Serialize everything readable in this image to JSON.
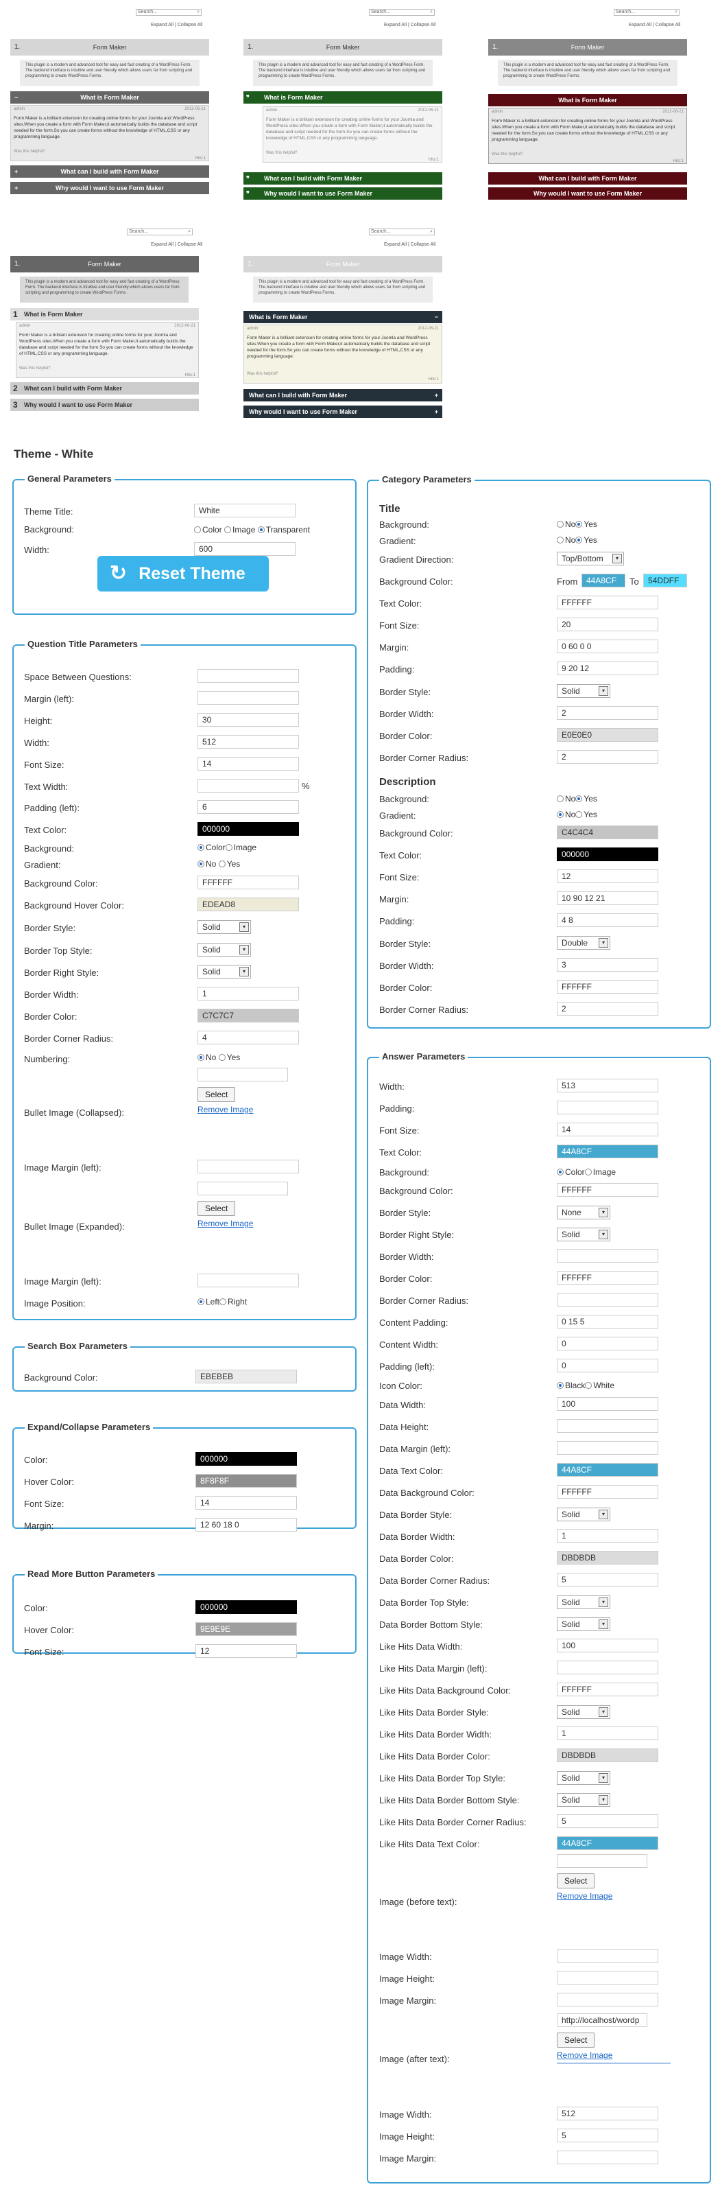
{
  "thumbs": {
    "search_placeholder": "Search...",
    "expand": "Expand All | Collapse All",
    "title": "Form Maker",
    "num": "1.",
    "desc": "This plugin is a modern and advanced tool for easy and fast creating of a WordPress Form. The backend interface is intuitive and user friendly which allows users far from scripting and programming to create WordPress Forms.",
    "q1": "What is Form Maker",
    "q2": "What can I build with Form Maker",
    "q3": "Why would I want to use Form Maker",
    "author": "admin",
    "date": "2012-06-21",
    "answer": "Form Maker is a brilliant extension for creating online forms for your Joomla and WordPress sites.When you create a form with Form Maker,it automatically builds the database and script needed for the form.So you can create forms without the knowledge of HTML,CSS or any programming language.",
    "was_helpful": "Was this helpful?",
    "hits": "Hits:1"
  },
  "colors": {
    "accent": "#3da3d8",
    "reset": "#3ab4ea",
    "t1": "#666666",
    "t2": "#1e5c1e",
    "t3": "#5a0b12",
    "t5": "#25313a"
  },
  "theme_heading": "Theme - White",
  "general": {
    "legend": "General Parameters",
    "theme_title_label": "Theme Title:",
    "theme_title": "White",
    "background_label": "Background:",
    "bg_color": "Color",
    "bg_image": "Image",
    "bg_transparent": "Transparent",
    "width_label": "Width:",
    "width": "600",
    "reset": "Reset Theme"
  },
  "qt": {
    "legend": "Question Title Parameters",
    "labels": [
      "Space Between Questions:",
      "Margin (left):",
      "Height:",
      "Width:",
      "Font Size:",
      "Text Width:",
      "Padding (left):",
      "Text Color:",
      "Background:",
      "Gradient:",
      "Background Color:",
      "Background Hover Color:",
      "Border Style:",
      "Border Top Style:",
      "Border Right Style:",
      "Border Width:",
      "Border Color:",
      "Border Corner Radius:",
      "Numbering:",
      "Bullet Image (Collapsed):",
      "Image Margin (left):",
      "Bullet Image (Expanded):",
      "Image Margin (left):",
      "Image Position:"
    ],
    "height": "30",
    "width": "512",
    "font_size": "14",
    "percent": "%",
    "padding_left": "6",
    "text_color": "000000",
    "bg_color_opt": "Color",
    "bg_image_opt": "Image",
    "no": "No",
    "yes": "Yes",
    "bg_color": "FFFFFF",
    "bg_hover": "EDEAD8",
    "border_style": "Solid",
    "border_top": "Solid",
    "border_right": "Solid",
    "border_width": "1",
    "border_color": "C7C7C7",
    "radius": "4",
    "select": "Select",
    "remove_image": "Remove Image",
    "left": "Left",
    "right": "Right"
  },
  "search": {
    "legend": "Search Box Parameters",
    "bg_label": "Background Color:",
    "bg": "EBEBEB"
  },
  "expand": {
    "legend": "Expand/Collapse Parameters",
    "color_label": "Color:",
    "color": "000000",
    "hover_label": "Hover Color:",
    "hover": "8F8F8F",
    "font_label": "Font Size:",
    "font": "14",
    "margin_label": "Margin:",
    "margin": "12 60 18 0"
  },
  "readmore": {
    "legend": "Read More Button Parameters",
    "color_label": "Color:",
    "color": "000000",
    "hover_label": "Hover Color:",
    "hover": "9E9E9E",
    "font_label": "Font Size:",
    "font": "12"
  },
  "category": {
    "legend": "Category Parameters",
    "title_h": "Title",
    "t_labels": [
      "Background:",
      "Gradient:",
      "Gradient Direction:",
      "Background Color:",
      "Text Color:",
      "Font Size:",
      "Margin:",
      "Padding:",
      "Border Style:",
      "Border Width:",
      "Border Color:",
      "Border Corner Radius:"
    ],
    "no": "No",
    "yes": "Yes",
    "direction": "Top/Bottom",
    "from": "From",
    "to": "To",
    "from_val": "44A8CF",
    "to_val": "54DDFF",
    "t_text_color": "FFFFFF",
    "t_font": "20",
    "t_margin": "0 60 0 0",
    "t_padding": "9 20 12",
    "t_border_style": "Solid",
    "t_border_width": "2",
    "t_border_color": "E0E0E0",
    "t_radius": "2",
    "desc_h": "Description",
    "d_labels": [
      "Background:",
      "Gradient:",
      "Background Color:",
      "Text Color:",
      "Font Size:",
      "Margin:",
      "Padding:",
      "Border Style:",
      "Border Width:",
      "Border Color:",
      "Border Corner Radius:"
    ],
    "d_bg": "C4C4C4",
    "d_text": "000000",
    "d_font": "12",
    "d_margin": "10 90 12 21",
    "d_padding": "4 8",
    "d_border_style": "Double",
    "d_border_width": "3",
    "d_border_color": "FFFFFF",
    "d_radius": "2"
  },
  "answer": {
    "legend": "Answer Parameters",
    "labels": [
      "Width:",
      "Padding:",
      "Font Size:",
      "Text Color:",
      "Background:",
      "Background Color:",
      "Border Style:",
      "Border Right Style:",
      "Border Width:",
      "Border Color:",
      "Border Corner Radius:",
      "Content Padding:",
      "Content Width:",
      "Padding (left):",
      "Icon Color:",
      "Data Width:",
      "Data Height:",
      "Data Margin (left):",
      "Data Text Color:",
      "Data Background Color:",
      "Data Border Style:",
      "Data Border Width:",
      "Data Border Color:",
      "Data Border Corner Radius:",
      "Data Border Top Style:",
      "Data Border Bottom Style:",
      "Like Hits Data Width:",
      "Like Hits Data Margin (left):",
      "Like Hits Data Background Color:",
      "Like Hits Data Border Style:",
      "Like Hits Data Border Width:",
      "Like Hits Data Border Color:",
      "Like Hits Data Border Top Style:",
      "Like Hits Data Border Bottom Style:",
      "Like Hits Data Border Corner Radius:",
      "Like Hits Data Text Color:",
      "Image (before text):",
      "Image Width:",
      "Image Height:",
      "Image Margin:",
      "Image (after text):",
      "Image Width:",
      "Image Height:",
      "Image Margin:"
    ],
    "width": "513",
    "font": "14",
    "text_color": "44A8CF",
    "bg_color_opt": "Color",
    "bg_image_opt": "Image",
    "bg_color": "FFFFFF",
    "border_style": "None",
    "border_right": "Solid",
    "border_color": "FFFFFF",
    "content_padding": "0 15 5",
    "content_width": "0",
    "padding_left": "0",
    "black": "Black",
    "white": "White",
    "data_width": "100",
    "data_text": "44A8CF",
    "data_bg": "FFFFFF",
    "data_border_style": "Solid",
    "data_border_width": "1",
    "data_border_color": "DBDBDB",
    "data_radius": "5",
    "data_top": "Solid",
    "data_bottom": "Solid",
    "lh_width": "100",
    "lh_bg": "FFFFFF",
    "lh_style": "Solid",
    "lh_width_b": "1",
    "lh_color": "DBDBDB",
    "lh_top": "Solid",
    "lh_bottom": "Solid",
    "lh_radius": "5",
    "lh_text": "44A8CF",
    "select": "Select",
    "remove_image": "Remove Image",
    "url": "http://localhost/wordp",
    "img_w": "512",
    "img_h": "5"
  }
}
